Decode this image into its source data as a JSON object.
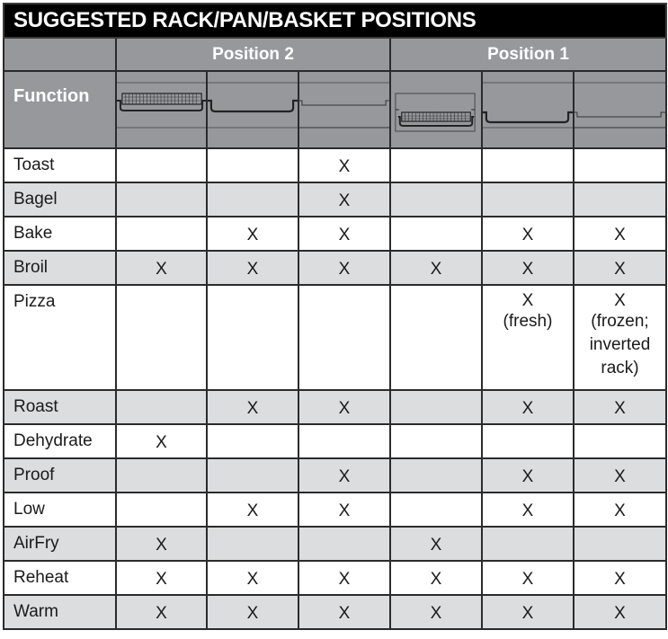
{
  "title": "SUGGESTED RACK/PAN/BASKET POSITIONS",
  "position_groups": [
    {
      "label": "Position 2",
      "span": 3
    },
    {
      "label": "Position 1",
      "span": 3
    }
  ],
  "function_header": "Function",
  "columns": [
    {
      "group": "Position 2",
      "accessory": "basket",
      "icon": "air-fry-basket-icon"
    },
    {
      "group": "Position 2",
      "accessory": "pan",
      "icon": "baking-pan-icon"
    },
    {
      "group": "Position 2",
      "accessory": "rack",
      "icon": "wire-rack-icon"
    },
    {
      "group": "Position 1",
      "accessory": "basket",
      "icon": "air-fry-basket-icon"
    },
    {
      "group": "Position 1",
      "accessory": "pan",
      "icon": "baking-pan-icon"
    },
    {
      "group": "Position 1",
      "accessory": "rack",
      "icon": "wire-rack-icon"
    }
  ],
  "rows": [
    {
      "function": "Toast",
      "cells": [
        "",
        "",
        "X",
        "",
        "",
        ""
      ]
    },
    {
      "function": "Bagel",
      "cells": [
        "",
        "",
        "X",
        "",
        "",
        ""
      ]
    },
    {
      "function": "Bake",
      "cells": [
        "",
        "X",
        "X",
        "",
        "X",
        "X"
      ]
    },
    {
      "function": "Broil",
      "cells": [
        "X",
        "X",
        "X",
        "X",
        "X",
        "X"
      ]
    },
    {
      "function": "Pizza",
      "cells": [
        "",
        "",
        "",
        "",
        "X",
        "X"
      ],
      "notes": [
        "",
        "",
        "",
        "",
        "(fresh)",
        "(frozen; inverted rack)"
      ]
    },
    {
      "function": "Roast",
      "cells": [
        "",
        "X",
        "X",
        "",
        "X",
        "X"
      ]
    },
    {
      "function": "Dehydrate",
      "cells": [
        "X",
        "",
        "",
        "",
        "",
        ""
      ]
    },
    {
      "function": "Proof",
      "cells": [
        "",
        "",
        "X",
        "",
        "X",
        "X"
      ]
    },
    {
      "function": "Low",
      "cells": [
        "",
        "X",
        "X",
        "",
        "X",
        "X"
      ]
    },
    {
      "function": "AirFry",
      "cells": [
        "X",
        "",
        "",
        "X",
        "",
        ""
      ]
    },
    {
      "function": "Reheat",
      "cells": [
        "X",
        "X",
        "X",
        "X",
        "X",
        "X"
      ]
    },
    {
      "function": "Warm",
      "cells": [
        "X",
        "X",
        "X",
        "X",
        "X",
        "X"
      ]
    }
  ],
  "colors": {
    "title_bg": "#000000",
    "header_bg": "#97989c",
    "header_text": "#ffffff",
    "row_alt_bg": "#dcdddf",
    "row_bg": "#ffffff",
    "border": "#2b2b2b"
  }
}
